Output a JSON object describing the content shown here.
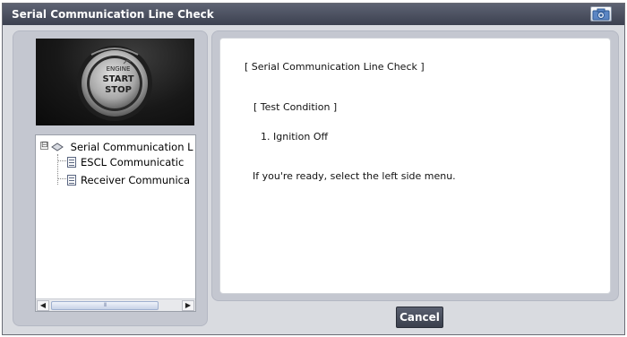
{
  "window": {
    "title": "Serial Communication Line Check"
  },
  "tree": {
    "root_label": "Serial Communication L",
    "expander": "⊟",
    "children": [
      {
        "label": "ESCL Communicatic"
      },
      {
        "label": "Receiver Communica"
      }
    ]
  },
  "photo": {
    "button_text_line1": "ENGINE",
    "button_text_line2": "START",
    "button_text_line3": "STOP"
  },
  "scrollbar": {
    "left_arrow": "◀",
    "right_arrow": "▶",
    "thumb_grip": "III"
  },
  "content": {
    "heading": "[ Serial Communication Line Check ]",
    "test_condition": "[ Test Condition ]",
    "step1": "1. Ignition Off",
    "instruction": "If you're ready, select the left side menu."
  },
  "buttons": {
    "cancel": "Cancel"
  },
  "colors": {
    "titlebar": "#4a4f5e",
    "panel": "#c4c7d0",
    "cancel_bg": "#4a4f5c"
  }
}
